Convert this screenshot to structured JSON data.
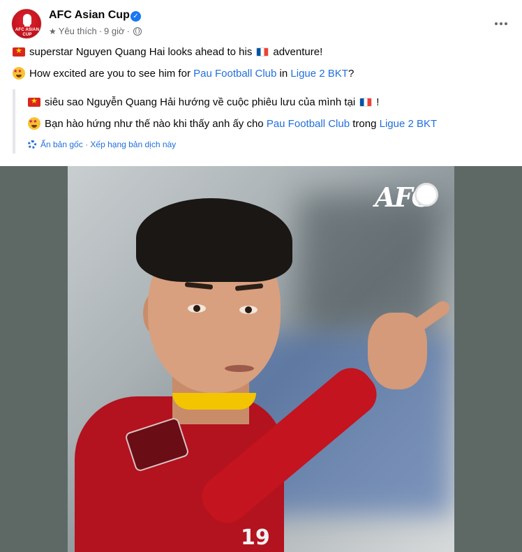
{
  "page": {
    "name": "AFC Asian Cup",
    "avatar_text": "AFC ASIAN CUP",
    "meta_like": "Yêu thích",
    "meta_time": "9 giờ",
    "meta_sep": "·"
  },
  "post": {
    "line1_text": "superstar Nguyen Quang Hai looks ahead to his",
    "line1_end": "adventure!",
    "line2_start": "How excited are you to see him for",
    "line2_link1": "Pau Football Club",
    "line2_mid": "in",
    "line2_link2": "Ligue 2 BKT",
    "line2_end": "?"
  },
  "translation": {
    "line1_text": "siêu sao Nguyễn Quang Hải hướng về cuộc phiêu lưu của mình tại",
    "line1_end": "!",
    "line2_start": "Bạn hào hứng như thế nào khi thấy anh ấy cho",
    "line2_link1": "Pau Football Club",
    "line2_mid": "trong",
    "line2_link2": "Ligue 2 BKT",
    "hide_original": "Ẩn bản gốc",
    "sep": "·",
    "rate": "Xếp hạng bản dịch này"
  },
  "image": {
    "watermark": "AFC",
    "jersey_number": "19"
  },
  "colors": {
    "link": "#216fdb",
    "verified": "#1877f2",
    "secondary_text": "#65676b"
  }
}
